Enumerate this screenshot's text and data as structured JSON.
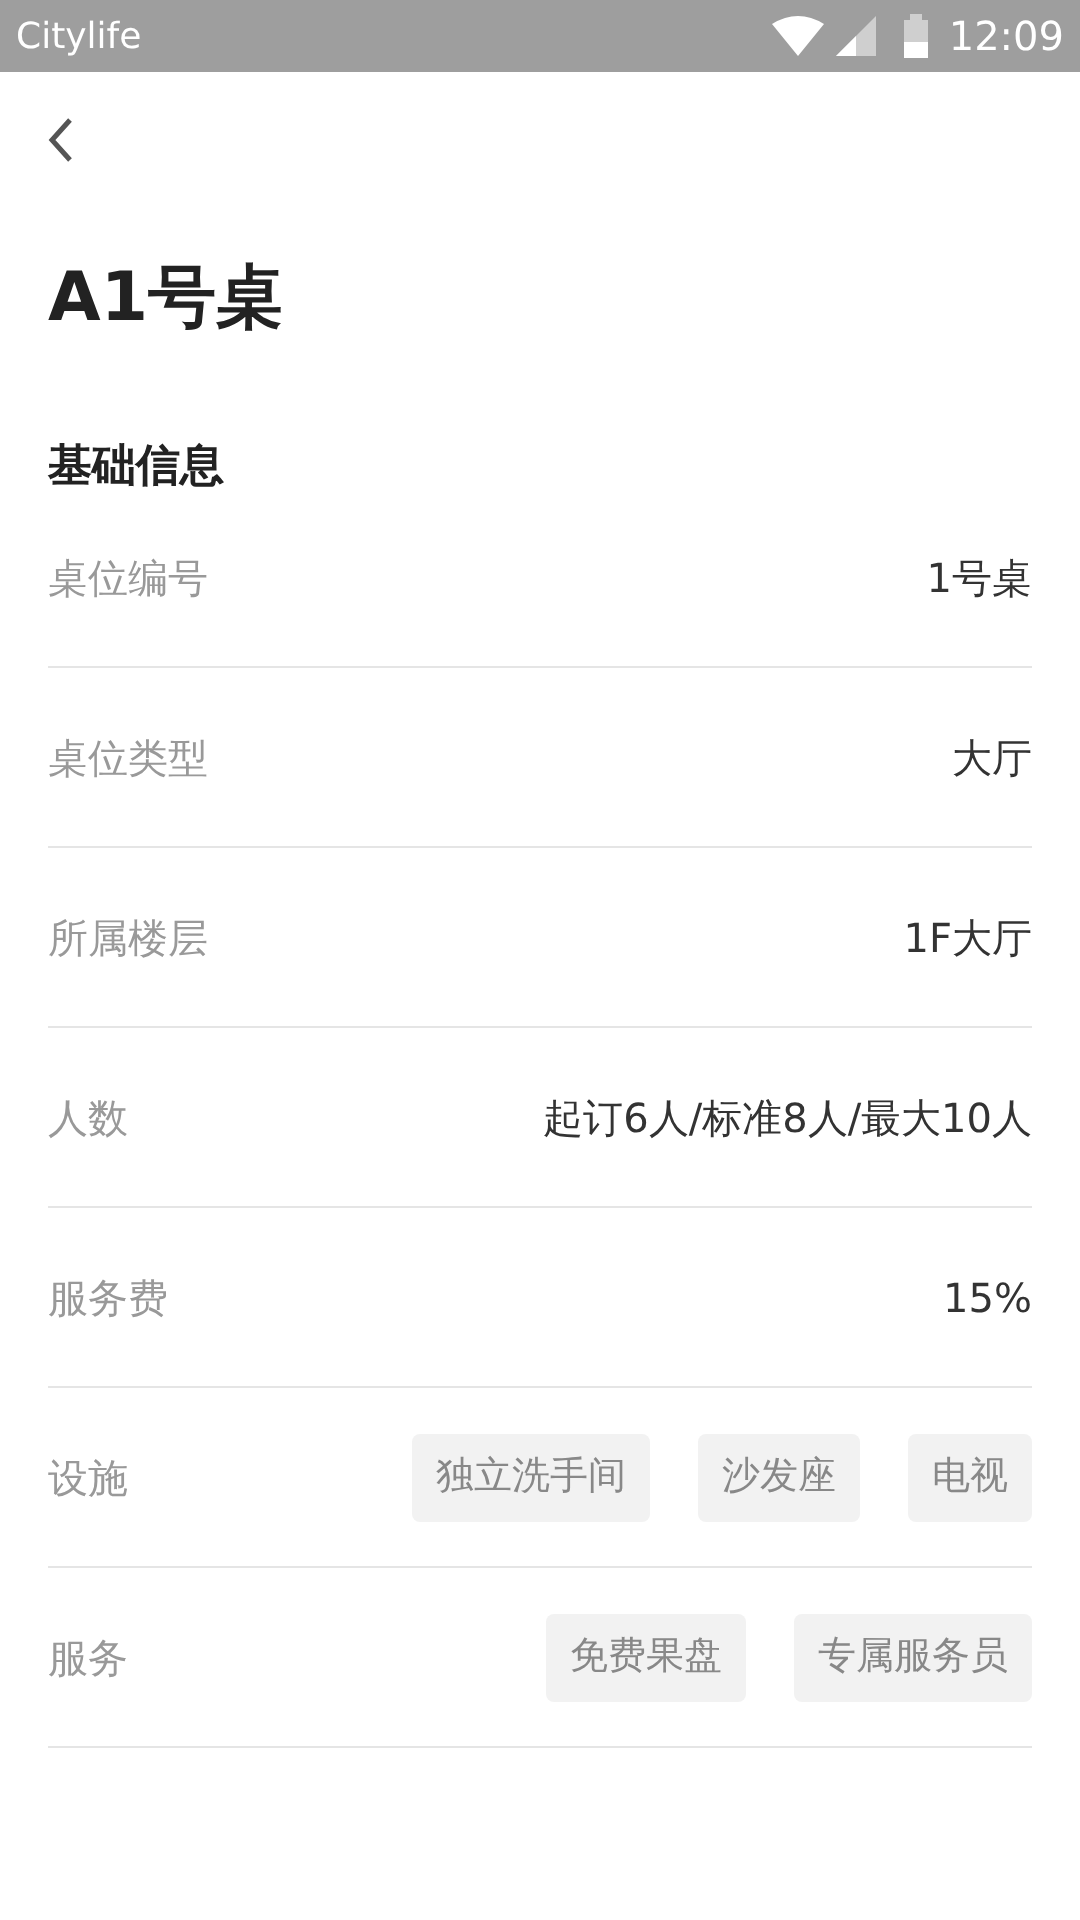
{
  "status_bar": {
    "app": "Citylife",
    "time": "12:09"
  },
  "title": "A1号桌",
  "section": "基础信息",
  "rows": [
    {
      "kind": "text",
      "label": "桌位编号",
      "value": "1号桌"
    },
    {
      "kind": "text",
      "label": "桌位类型",
      "value": "大厅"
    },
    {
      "kind": "text",
      "label": "所属楼层",
      "value": "1F大厅"
    },
    {
      "kind": "text",
      "label": "人数",
      "value": "起订6人/标准8人/最大10人"
    },
    {
      "kind": "text",
      "label": "服务费",
      "value": "15%"
    },
    {
      "kind": "tags",
      "label": "设施",
      "tags": [
        "独立洗手间",
        "沙发座",
        "电视"
      ]
    },
    {
      "kind": "tags",
      "label": "服务",
      "tags": [
        "免费果盘",
        "专属服务员"
      ]
    }
  ]
}
